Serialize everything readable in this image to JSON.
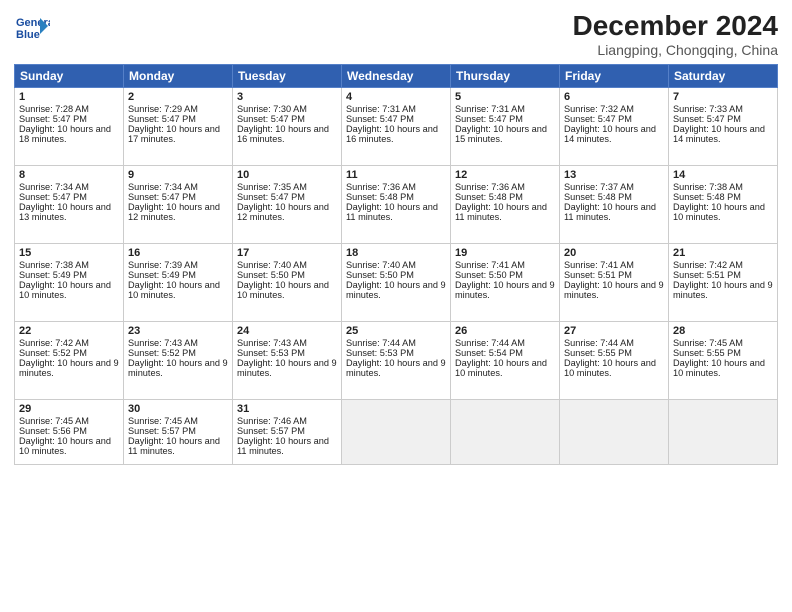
{
  "header": {
    "logo_line1": "General",
    "logo_line2": "Blue",
    "title": "December 2024",
    "subtitle": "Liangping, Chongqing, China"
  },
  "days_of_week": [
    "Sunday",
    "Monday",
    "Tuesday",
    "Wednesday",
    "Thursday",
    "Friday",
    "Saturday"
  ],
  "weeks": [
    [
      {
        "day": 1,
        "rise": "7:28 AM",
        "set": "5:47 PM",
        "daylight": "10 hours and 18 minutes."
      },
      {
        "day": 2,
        "rise": "7:29 AM",
        "set": "5:47 PM",
        "daylight": "10 hours and 17 minutes."
      },
      {
        "day": 3,
        "rise": "7:30 AM",
        "set": "5:47 PM",
        "daylight": "10 hours and 16 minutes."
      },
      {
        "day": 4,
        "rise": "7:31 AM",
        "set": "5:47 PM",
        "daylight": "10 hours and 16 minutes."
      },
      {
        "day": 5,
        "rise": "7:31 AM",
        "set": "5:47 PM",
        "daylight": "10 hours and 15 minutes."
      },
      {
        "day": 6,
        "rise": "7:32 AM",
        "set": "5:47 PM",
        "daylight": "10 hours and 14 minutes."
      },
      {
        "day": 7,
        "rise": "7:33 AM",
        "set": "5:47 PM",
        "daylight": "10 hours and 14 minutes."
      }
    ],
    [
      {
        "day": 8,
        "rise": "7:34 AM",
        "set": "5:47 PM",
        "daylight": "10 hours and 13 minutes."
      },
      {
        "day": 9,
        "rise": "7:34 AM",
        "set": "5:47 PM",
        "daylight": "10 hours and 12 minutes."
      },
      {
        "day": 10,
        "rise": "7:35 AM",
        "set": "5:47 PM",
        "daylight": "10 hours and 12 minutes."
      },
      {
        "day": 11,
        "rise": "7:36 AM",
        "set": "5:48 PM",
        "daylight": "10 hours and 11 minutes."
      },
      {
        "day": 12,
        "rise": "7:36 AM",
        "set": "5:48 PM",
        "daylight": "10 hours and 11 minutes."
      },
      {
        "day": 13,
        "rise": "7:37 AM",
        "set": "5:48 PM",
        "daylight": "10 hours and 11 minutes."
      },
      {
        "day": 14,
        "rise": "7:38 AM",
        "set": "5:48 PM",
        "daylight": "10 hours and 10 minutes."
      }
    ],
    [
      {
        "day": 15,
        "rise": "7:38 AM",
        "set": "5:49 PM",
        "daylight": "10 hours and 10 minutes."
      },
      {
        "day": 16,
        "rise": "7:39 AM",
        "set": "5:49 PM",
        "daylight": "10 hours and 10 minutes."
      },
      {
        "day": 17,
        "rise": "7:40 AM",
        "set": "5:50 PM",
        "daylight": "10 hours and 10 minutes."
      },
      {
        "day": 18,
        "rise": "7:40 AM",
        "set": "5:50 PM",
        "daylight": "10 hours and 9 minutes."
      },
      {
        "day": 19,
        "rise": "7:41 AM",
        "set": "5:50 PM",
        "daylight": "10 hours and 9 minutes."
      },
      {
        "day": 20,
        "rise": "7:41 AM",
        "set": "5:51 PM",
        "daylight": "10 hours and 9 minutes."
      },
      {
        "day": 21,
        "rise": "7:42 AM",
        "set": "5:51 PM",
        "daylight": "10 hours and 9 minutes."
      }
    ],
    [
      {
        "day": 22,
        "rise": "7:42 AM",
        "set": "5:52 PM",
        "daylight": "10 hours and 9 minutes."
      },
      {
        "day": 23,
        "rise": "7:43 AM",
        "set": "5:52 PM",
        "daylight": "10 hours and 9 minutes."
      },
      {
        "day": 24,
        "rise": "7:43 AM",
        "set": "5:53 PM",
        "daylight": "10 hours and 9 minutes."
      },
      {
        "day": 25,
        "rise": "7:44 AM",
        "set": "5:53 PM",
        "daylight": "10 hours and 9 minutes."
      },
      {
        "day": 26,
        "rise": "7:44 AM",
        "set": "5:54 PM",
        "daylight": "10 hours and 10 minutes."
      },
      {
        "day": 27,
        "rise": "7:44 AM",
        "set": "5:55 PM",
        "daylight": "10 hours and 10 minutes."
      },
      {
        "day": 28,
        "rise": "7:45 AM",
        "set": "5:55 PM",
        "daylight": "10 hours and 10 minutes."
      }
    ],
    [
      {
        "day": 29,
        "rise": "7:45 AM",
        "set": "5:56 PM",
        "daylight": "10 hours and 10 minutes."
      },
      {
        "day": 30,
        "rise": "7:45 AM",
        "set": "5:57 PM",
        "daylight": "10 hours and 11 minutes."
      },
      {
        "day": 31,
        "rise": "7:46 AM",
        "set": "5:57 PM",
        "daylight": "10 hours and 11 minutes."
      },
      null,
      null,
      null,
      null
    ]
  ]
}
